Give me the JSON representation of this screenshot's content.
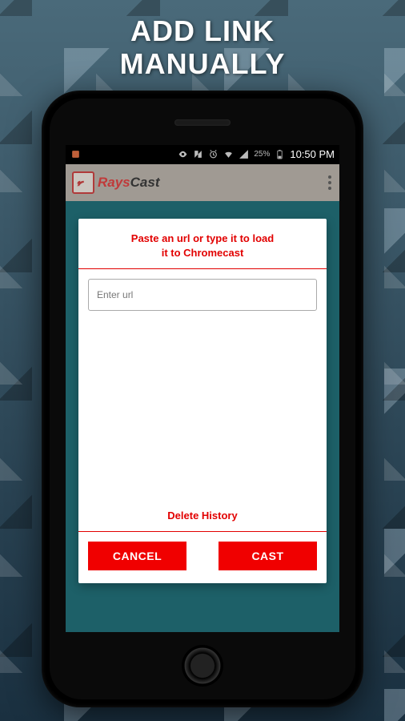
{
  "promo": {
    "line1": "ADD LINK",
    "line2": "MANUALLY"
  },
  "status_bar": {
    "battery_percent": "25%",
    "clock": "10:50 PM"
  },
  "header": {
    "brand_part1": "Rays",
    "brand_part2": "Cast"
  },
  "dialog": {
    "title_line1": "Paste an url or type it to load",
    "title_line2": "it to Chromecast",
    "url_placeholder": "Enter url",
    "url_value": "",
    "delete_history_label": "Delete History",
    "cancel_label": "CANCEL",
    "cast_label": "CAST"
  }
}
